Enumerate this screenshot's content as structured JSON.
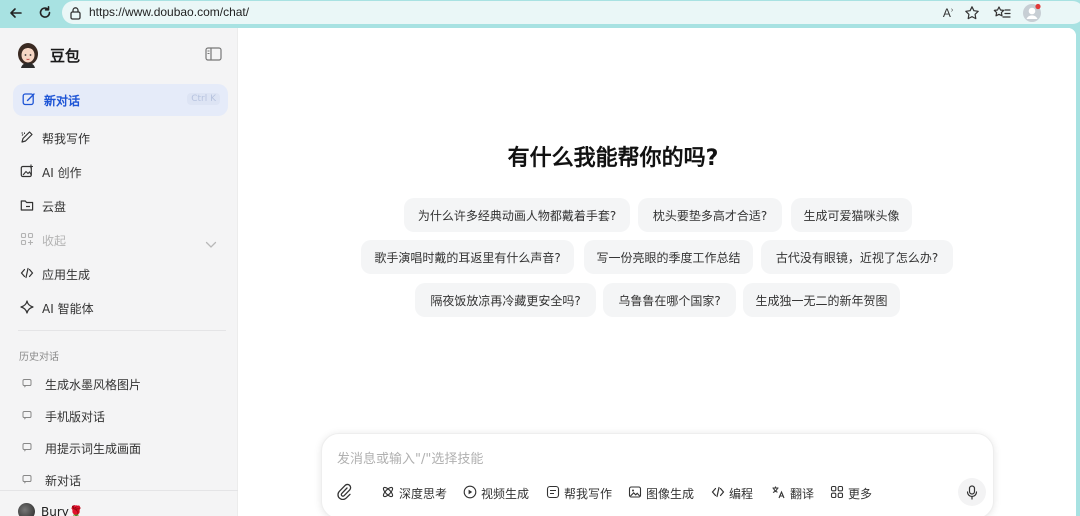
{
  "browser": {
    "url": "https://www.doubao.com/chat/",
    "icons": [
      "back-icon",
      "reload-icon",
      "lock-icon",
      "read-aloud-icon",
      "favorite-star-icon",
      "favorites-list-icon",
      "profile-icon"
    ]
  },
  "sidebar": {
    "brand": "豆包",
    "new_chat": {
      "label": "新对话",
      "shortcut": "Ctrl K"
    },
    "items": [
      {
        "label": "帮我写作",
        "icon": "pen-icon"
      },
      {
        "label": "AI 创作",
        "icon": "image-create-icon"
      },
      {
        "label": "云盘",
        "icon": "folder-icon"
      },
      {
        "label": "收起",
        "icon": "grid-icon"
      },
      {
        "label": "应用生成",
        "icon": "code-icon"
      },
      {
        "label": "AI 智能体",
        "icon": "sparkle-icon"
      }
    ],
    "history_title": "历史对话",
    "history": [
      {
        "label": "生成水墨风格图片"
      },
      {
        "label": "手机版对话"
      },
      {
        "label": "用提示词生成画面"
      },
      {
        "label": "新对话"
      }
    ],
    "user": {
      "name": "Bury🌹"
    }
  },
  "main": {
    "headline": "有什么我能帮你的吗?",
    "suggestions": [
      "为什么许多经典动画人物都戴着手套?",
      "枕头要垫多高才合适?",
      "生成可爱猫咪头像",
      "歌手演唱时戴的耳返里有什么声音?",
      "写一份亮眼的季度工作总结",
      "古代没有眼镜，近视了怎么办?",
      "隔夜饭放凉再冷藏更安全吗?",
      "乌鲁鲁在哪个国家?",
      "生成独一无二的新年贺图"
    ],
    "composer": {
      "placeholder": "发消息或输入\"/\"选择技能",
      "tools": [
        {
          "label": "深度思考",
          "icon": "deep-think-icon"
        },
        {
          "label": "视频生成",
          "icon": "video-icon"
        },
        {
          "label": "帮我写作",
          "icon": "write-icon"
        },
        {
          "label": "图像生成",
          "icon": "image-icon"
        },
        {
          "label": "编程",
          "icon": "code-icon"
        },
        {
          "label": "翻译",
          "icon": "translate-icon"
        },
        {
          "label": "更多",
          "icon": "more-icon"
        }
      ]
    }
  },
  "colors": {
    "browser_bg": "#a8e2e2",
    "accent": "#1e55d6",
    "sidebar_bg": "#f4f4f5",
    "chip_bg": "#f4f5f6"
  }
}
